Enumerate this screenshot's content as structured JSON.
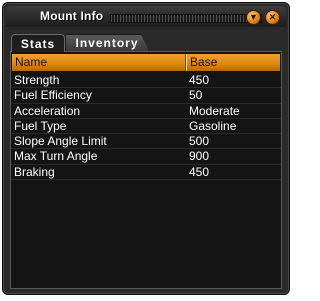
{
  "window": {
    "title": "Mount Info",
    "collapse_glyph": "▼",
    "close_glyph": "✕"
  },
  "tabs": [
    {
      "label": "Stats",
      "active": true
    },
    {
      "label": "Inventory",
      "active": false
    }
  ],
  "table": {
    "columns": [
      "Name",
      "Base"
    ],
    "rows": [
      {
        "name": "Strength",
        "base": "450"
      },
      {
        "name": "Fuel Efficiency",
        "base": "50"
      },
      {
        "name": "Acceleration",
        "base": "Moderate"
      },
      {
        "name": "Fuel Type",
        "base": "Gasoline"
      },
      {
        "name": "Slope Angle Limit",
        "base": "500"
      },
      {
        "name": "Max Turn Angle",
        "base": "900"
      },
      {
        "name": "Braking",
        "base": "450"
      }
    ]
  },
  "colors": {
    "accent": "#e08a10",
    "window_bg": "#2a2a2a",
    "panel_bg": "#141414",
    "text": "#ffffff"
  },
  "icons": {
    "collapse": "collapse-icon",
    "close": "close-icon"
  }
}
